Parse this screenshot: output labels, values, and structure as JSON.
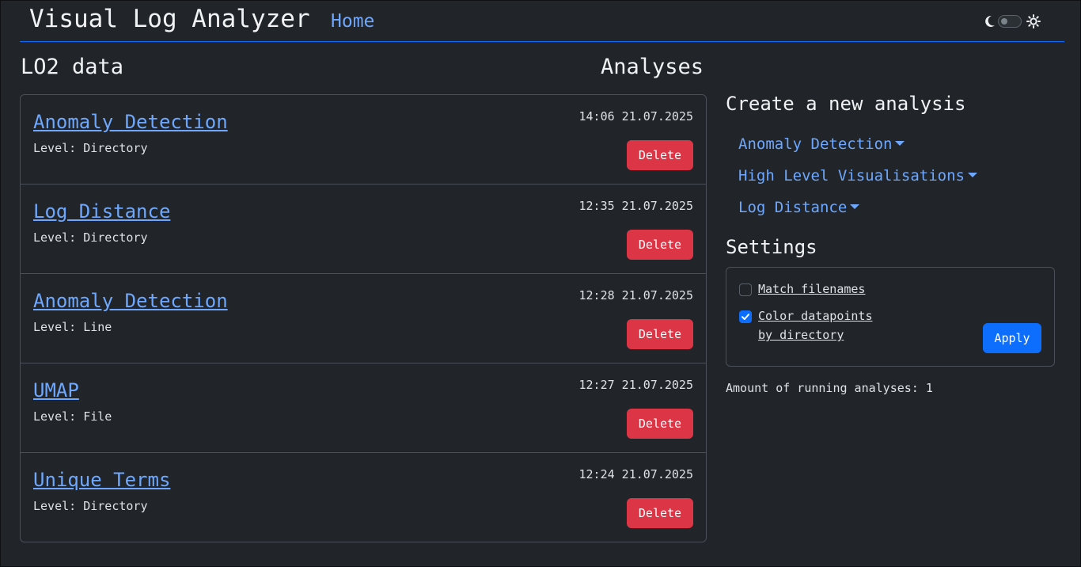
{
  "header": {
    "app_title": "Visual Log Analyzer",
    "home_link": "Home",
    "theme_toggle": {
      "dark_icon": "moon-icon",
      "light_icon": "sun-icon",
      "checked": false
    }
  },
  "main": {
    "dataset_title": "LO2 data",
    "analyses_title": "Analyses",
    "analyses": [
      {
        "name": "Anomaly Detection",
        "level": "Level: Directory",
        "time": "14:06 21.07.2025",
        "delete_label": "Delete"
      },
      {
        "name": "Log Distance",
        "level": "Level: Directory",
        "time": "12:35 21.07.2025",
        "delete_label": "Delete"
      },
      {
        "name": "Anomaly Detection",
        "level": "Level: Line",
        "time": "12:28 21.07.2025",
        "delete_label": "Delete"
      },
      {
        "name": "UMAP",
        "level": "Level: File",
        "time": "12:27 21.07.2025",
        "delete_label": "Delete"
      },
      {
        "name": "Unique Terms",
        "level": "Level: Directory",
        "time": "12:24 21.07.2025",
        "delete_label": "Delete"
      }
    ]
  },
  "sidebar": {
    "create_title": "Create a new analysis",
    "dropdowns": [
      {
        "label": "Anomaly Detection"
      },
      {
        "label": "High Level Visualisations"
      },
      {
        "label": "Log Distance"
      }
    ],
    "settings_title": "Settings",
    "settings": {
      "match_filenames": {
        "label": "Match filenames",
        "checked": false
      },
      "color_by_directory": {
        "label": "Color datapoints by directory",
        "checked": true
      },
      "apply_label": "Apply"
    },
    "running_text": "Amount of running analyses: 1"
  },
  "colors": {
    "background": "#212529",
    "accent": "#0d6efd",
    "link": "#6ea8fe",
    "danger": "#dc3545"
  }
}
